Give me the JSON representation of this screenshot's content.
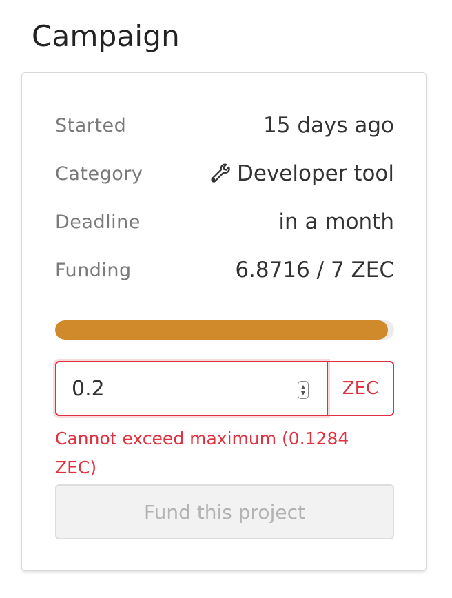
{
  "title": "Campaign",
  "details": {
    "started_label": "Started",
    "started_value": "15 days ago",
    "category_label": "Category",
    "category_icon": "wrench-icon",
    "category_value": "Developer tool",
    "deadline_label": "Deadline",
    "deadline_value": "in a month",
    "funding_label": "Funding",
    "funding_value": "6.8716 / 7 ZEC"
  },
  "progress": {
    "fraction": 0.9817
  },
  "contribution": {
    "amount_value": "0.2",
    "unit": "ZEC",
    "error": "Cannot exceed maximum (0.1284 ZEC)"
  },
  "fund_button_label": "Fund this project",
  "colors": {
    "accent": "#d08a2b",
    "error": "#e0313f",
    "disabled_bg": "#f2f2f2"
  }
}
